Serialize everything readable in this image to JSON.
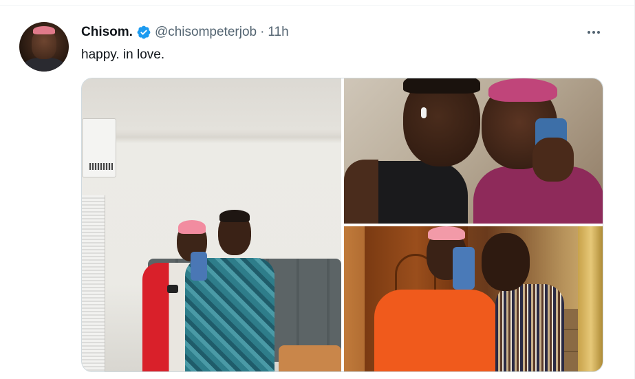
{
  "tweet": {
    "display_name": "Chisom.",
    "handle": "@chisompeterjob",
    "separator": "·",
    "time": "11h",
    "text": "happy. in love.",
    "verified": true,
    "verified_color": "#1d9bf0",
    "more_icon": "more-horizontal-icon"
  },
  "media": {
    "count": 3
  },
  "colors": {
    "text_primary": "#0f1419",
    "text_secondary": "#536471",
    "border": "#cfd9de"
  }
}
